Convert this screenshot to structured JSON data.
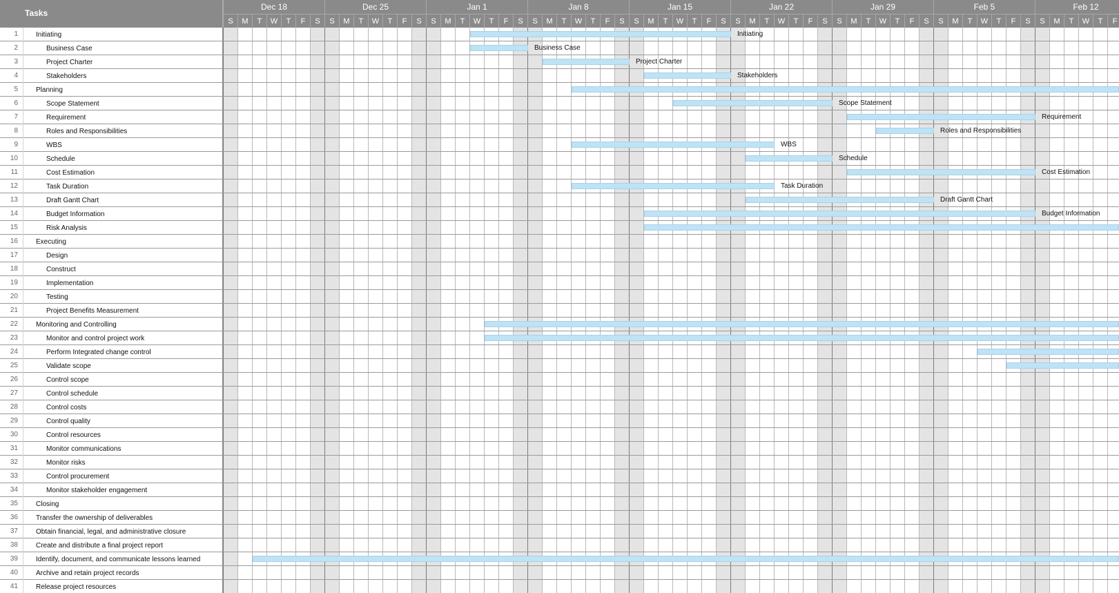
{
  "header": {
    "tasks_title": "Tasks",
    "weeks": [
      "Dec 18",
      "Dec 25",
      "Jan 1",
      "Jan 8",
      "Jan 15",
      "Jan 22",
      "Jan 29",
      "Feb 5",
      "Feb 12"
    ],
    "day_letters": [
      "S",
      "M",
      "T",
      "W",
      "T",
      "F",
      "S"
    ]
  },
  "tasks": [
    {
      "num": "1",
      "name": "Initiating",
      "level": 0,
      "start": 17,
      "end": 35,
      "label": "Initiating"
    },
    {
      "num": "2",
      "name": "Business Case",
      "level": 1,
      "start": 17,
      "end": 21,
      "label": "Business Case"
    },
    {
      "num": "3",
      "name": "Project Charter",
      "level": 1,
      "start": 22,
      "end": 28,
      "label": "Project Charter"
    },
    {
      "num": "4",
      "name": "Stakeholders",
      "level": 1,
      "start": 29,
      "end": 35,
      "label": "Stakeholders"
    },
    {
      "num": "5",
      "name": "Planning",
      "level": 0,
      "start": 24,
      "end": 63,
      "label": ""
    },
    {
      "num": "6",
      "name": "Scope Statement",
      "level": 1,
      "start": 31,
      "end": 42,
      "label": "Scope Statement"
    },
    {
      "num": "7",
      "name": "Requirement",
      "level": 1,
      "start": 43,
      "end": 56,
      "label": "Requirement"
    },
    {
      "num": "8",
      "name": "Roles and Responsibilities",
      "level": 1,
      "start": 45,
      "end": 49,
      "label": "Roles and Responsibilities"
    },
    {
      "num": "9",
      "name": "WBS",
      "level": 1,
      "start": 24,
      "end": 38,
      "label": "WBS"
    },
    {
      "num": "10",
      "name": "Schedule",
      "level": 1,
      "start": 36,
      "end": 42,
      "label": "Schedule"
    },
    {
      "num": "11",
      "name": "Cost Estimation",
      "level": 1,
      "start": 43,
      "end": 56,
      "label": "Cost Estimation"
    },
    {
      "num": "12",
      "name": "Task Duration",
      "level": 1,
      "start": 24,
      "end": 38,
      "label": "Task Duration"
    },
    {
      "num": "13",
      "name": "Draft Gantt Chart",
      "level": 1,
      "start": 36,
      "end": 49,
      "label": "Draft Gantt Chart"
    },
    {
      "num": "14",
      "name": "Budget Information",
      "level": 1,
      "start": 29,
      "end": 56,
      "label": "Budget Information"
    },
    {
      "num": "15",
      "name": "Risk Analysis",
      "level": 1,
      "start": 29,
      "end": 63,
      "label": ""
    },
    {
      "num": "16",
      "name": "Executing",
      "level": 0
    },
    {
      "num": "17",
      "name": "Design",
      "level": 1
    },
    {
      "num": "18",
      "name": "Construct",
      "level": 1
    },
    {
      "num": "19",
      "name": "Implementation",
      "level": 1
    },
    {
      "num": "20",
      "name": "Testing",
      "level": 1
    },
    {
      "num": "21",
      "name": "Project Benefits Measurement",
      "level": 1
    },
    {
      "num": "22",
      "name": "Monitoring and Controlling",
      "level": 0,
      "start": 18,
      "end": 63,
      "label": ""
    },
    {
      "num": "23",
      "name": "Monitor and control project work",
      "level": 1,
      "start": 18,
      "end": 63,
      "label": ""
    },
    {
      "num": "24",
      "name": "Perform Integrated change control",
      "level": 1,
      "start": 52,
      "end": 63,
      "label": ""
    },
    {
      "num": "25",
      "name": "Validate scope",
      "level": 1,
      "start": 54,
      "end": 63,
      "label": ""
    },
    {
      "num": "26",
      "name": "Control scope",
      "level": 1
    },
    {
      "num": "27",
      "name": "Control schedule",
      "level": 1
    },
    {
      "num": "28",
      "name": "Control costs",
      "level": 1
    },
    {
      "num": "29",
      "name": "Control quality",
      "level": 1
    },
    {
      "num": "30",
      "name": "Control resources",
      "level": 1
    },
    {
      "num": "31",
      "name": "Monitor communications",
      "level": 1
    },
    {
      "num": "32",
      "name": "Monitor risks",
      "level": 1
    },
    {
      "num": "33",
      "name": "Control procurement",
      "level": 1
    },
    {
      "num": "34",
      "name": "Monitor stakeholder engagement",
      "level": 1
    },
    {
      "num": "35",
      "name": "Closing",
      "level": 0
    },
    {
      "num": "36",
      "name": "Transfer the ownership of deliverables",
      "level": 0
    },
    {
      "num": "37",
      "name": "Obtain financial, legal, and administrative closure",
      "level": 0
    },
    {
      "num": "38",
      "name": "Create and distribute a final project report",
      "level": 0
    },
    {
      "num": "39",
      "name": "Identify, document, and communicate lessons learned",
      "level": 0,
      "start": 2,
      "end": 63,
      "label": ""
    },
    {
      "num": "40",
      "name": "Archive and retain project records",
      "level": 0
    },
    {
      "num": "41",
      "name": "Release project resources",
      "level": 0
    }
  ],
  "colors": {
    "header_bg": "#8a8a8a",
    "bar_fill": "#bfe3f5",
    "weekend_fill": "#e4e4e4"
  }
}
